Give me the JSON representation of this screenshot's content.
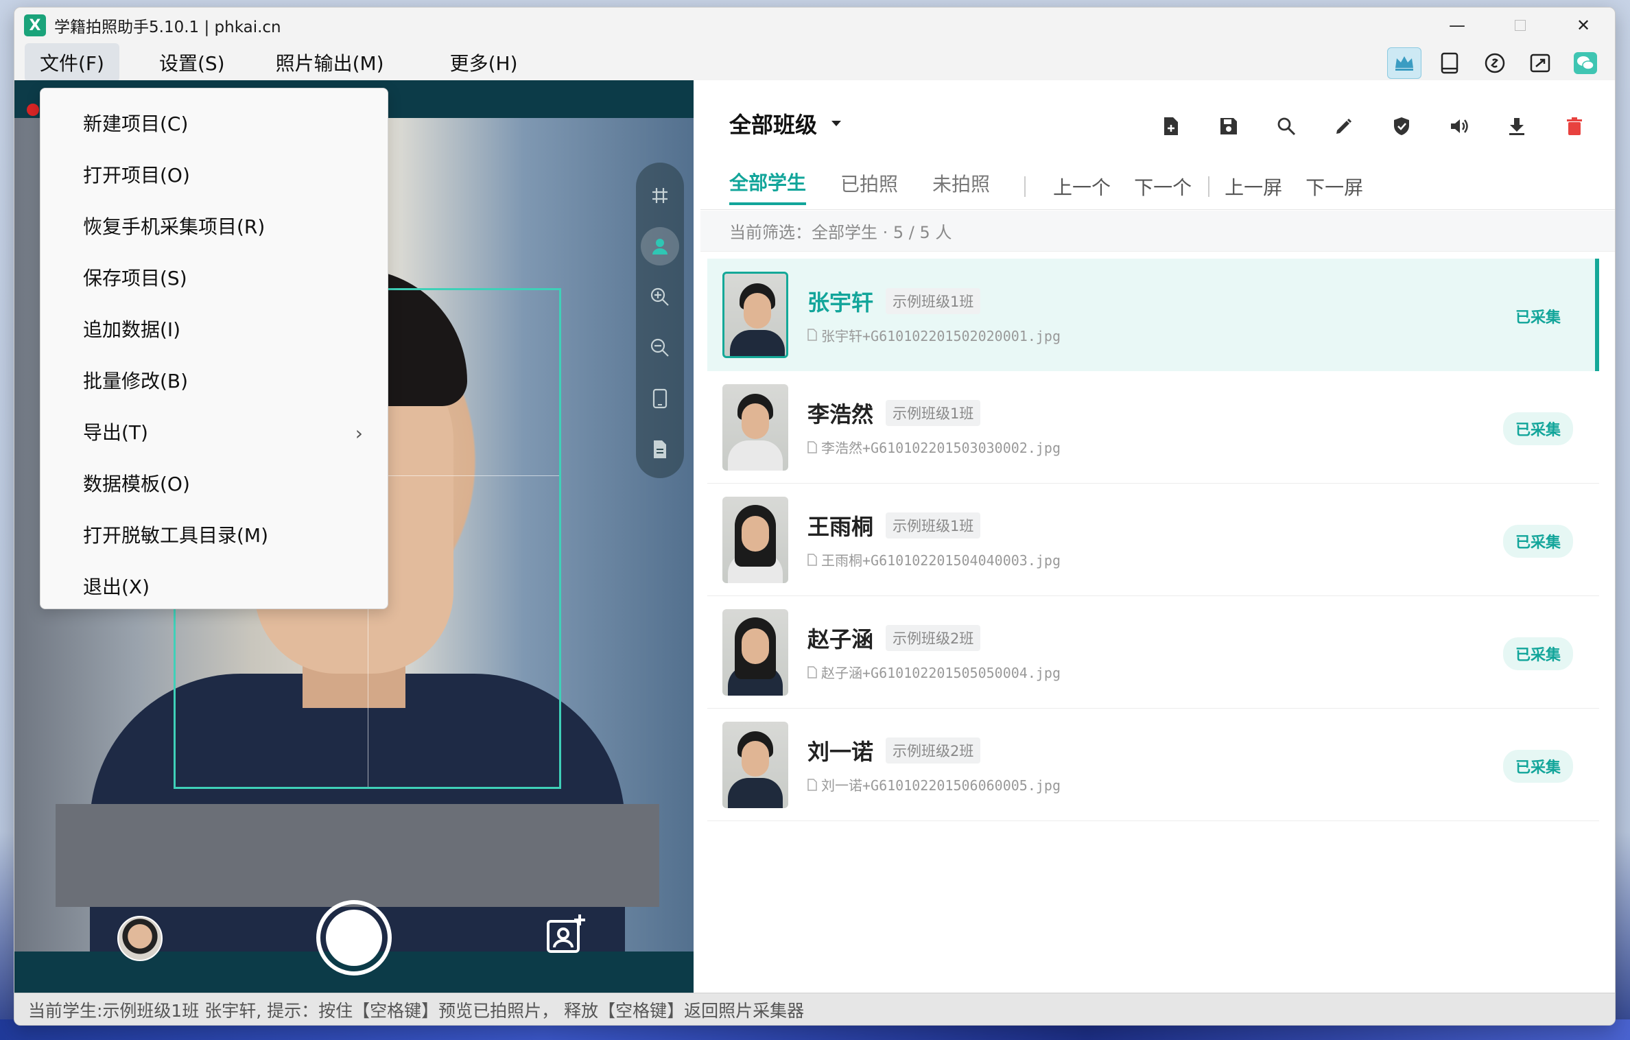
{
  "window": {
    "title": "学籍拍照助手5.10.1 | phkai.cn",
    "logo_letter": "X",
    "accent_color": "#12a59a"
  },
  "menubar": {
    "items": [
      "文件(F)",
      "设置(S)",
      "照片输出(M)",
      "更多(H)"
    ],
    "active_index": 0
  },
  "quick_icons": [
    "crown-icon",
    "tablet-icon",
    "link-icon",
    "transfer-icon",
    "wechat-icon"
  ],
  "file_menu": {
    "items": [
      {
        "label": "新建项目(C)"
      },
      {
        "label": "打开项目(O)"
      },
      {
        "label": "恢复手机采集项目(R)"
      },
      {
        "label": "保存项目(S)"
      },
      {
        "label": "追加数据(I)"
      },
      {
        "label": "批量修改(B)"
      },
      {
        "label": "导出(T)",
        "submenu_arrow": "›"
      },
      {
        "label": "数据模板(O)"
      },
      {
        "label": "打开脱敏工具目录(M)"
      },
      {
        "label": "退出(X)"
      }
    ]
  },
  "camera": {
    "side_tools": [
      "grid-icon",
      "person-icon",
      "zoom-in-icon",
      "zoom-out-icon",
      "phone-icon",
      "document-icon"
    ],
    "active_tool": "person-icon"
  },
  "right": {
    "class_selector": "全部班级",
    "toolbar_icons": [
      "new-file-icon",
      "save-icon",
      "search-icon",
      "edit-icon",
      "shield-icon",
      "speaker-icon",
      "download-icon",
      "delete-icon"
    ],
    "tabs": [
      "全部学生",
      "已拍照",
      "未拍照"
    ],
    "active_tab": 0,
    "nav_buttons": {
      "prev": "上一个",
      "next": "下一个",
      "prev_screen": "上一屏",
      "next_screen": "下一屏"
    },
    "filter_text": "当前筛选：全部学生 · 5 / 5 人"
  },
  "students": [
    {
      "name": "张宇轩",
      "class": "示例班级1班",
      "file": "张宇轩+G610102201502020001.jpg",
      "status": "已采集",
      "selected": true,
      "look": "boy"
    },
    {
      "name": "李浩然",
      "class": "示例班级1班",
      "file": "李浩然+G610102201503030002.jpg",
      "status": "已采集",
      "selected": false,
      "look": "boy-white"
    },
    {
      "name": "王雨桐",
      "class": "示例班级1班",
      "file": "王雨桐+G610102201504040003.jpg",
      "status": "已采集",
      "selected": false,
      "look": "girl-white"
    },
    {
      "name": "赵子涵",
      "class": "示例班级2班",
      "file": "赵子涵+G610102201505050004.jpg",
      "status": "已采集",
      "selected": false,
      "look": "girl"
    },
    {
      "name": "刘一诺",
      "class": "示例班级2班",
      "file": "刘一诺+G610102201506060005.jpg",
      "status": "已采集",
      "selected": false,
      "look": "boy"
    }
  ],
  "statusbar": "当前学生:示例班级1班 张宇轩, 提示：按住【空格键】预览已拍照片， 释放【空格键】返回照片采集器"
}
